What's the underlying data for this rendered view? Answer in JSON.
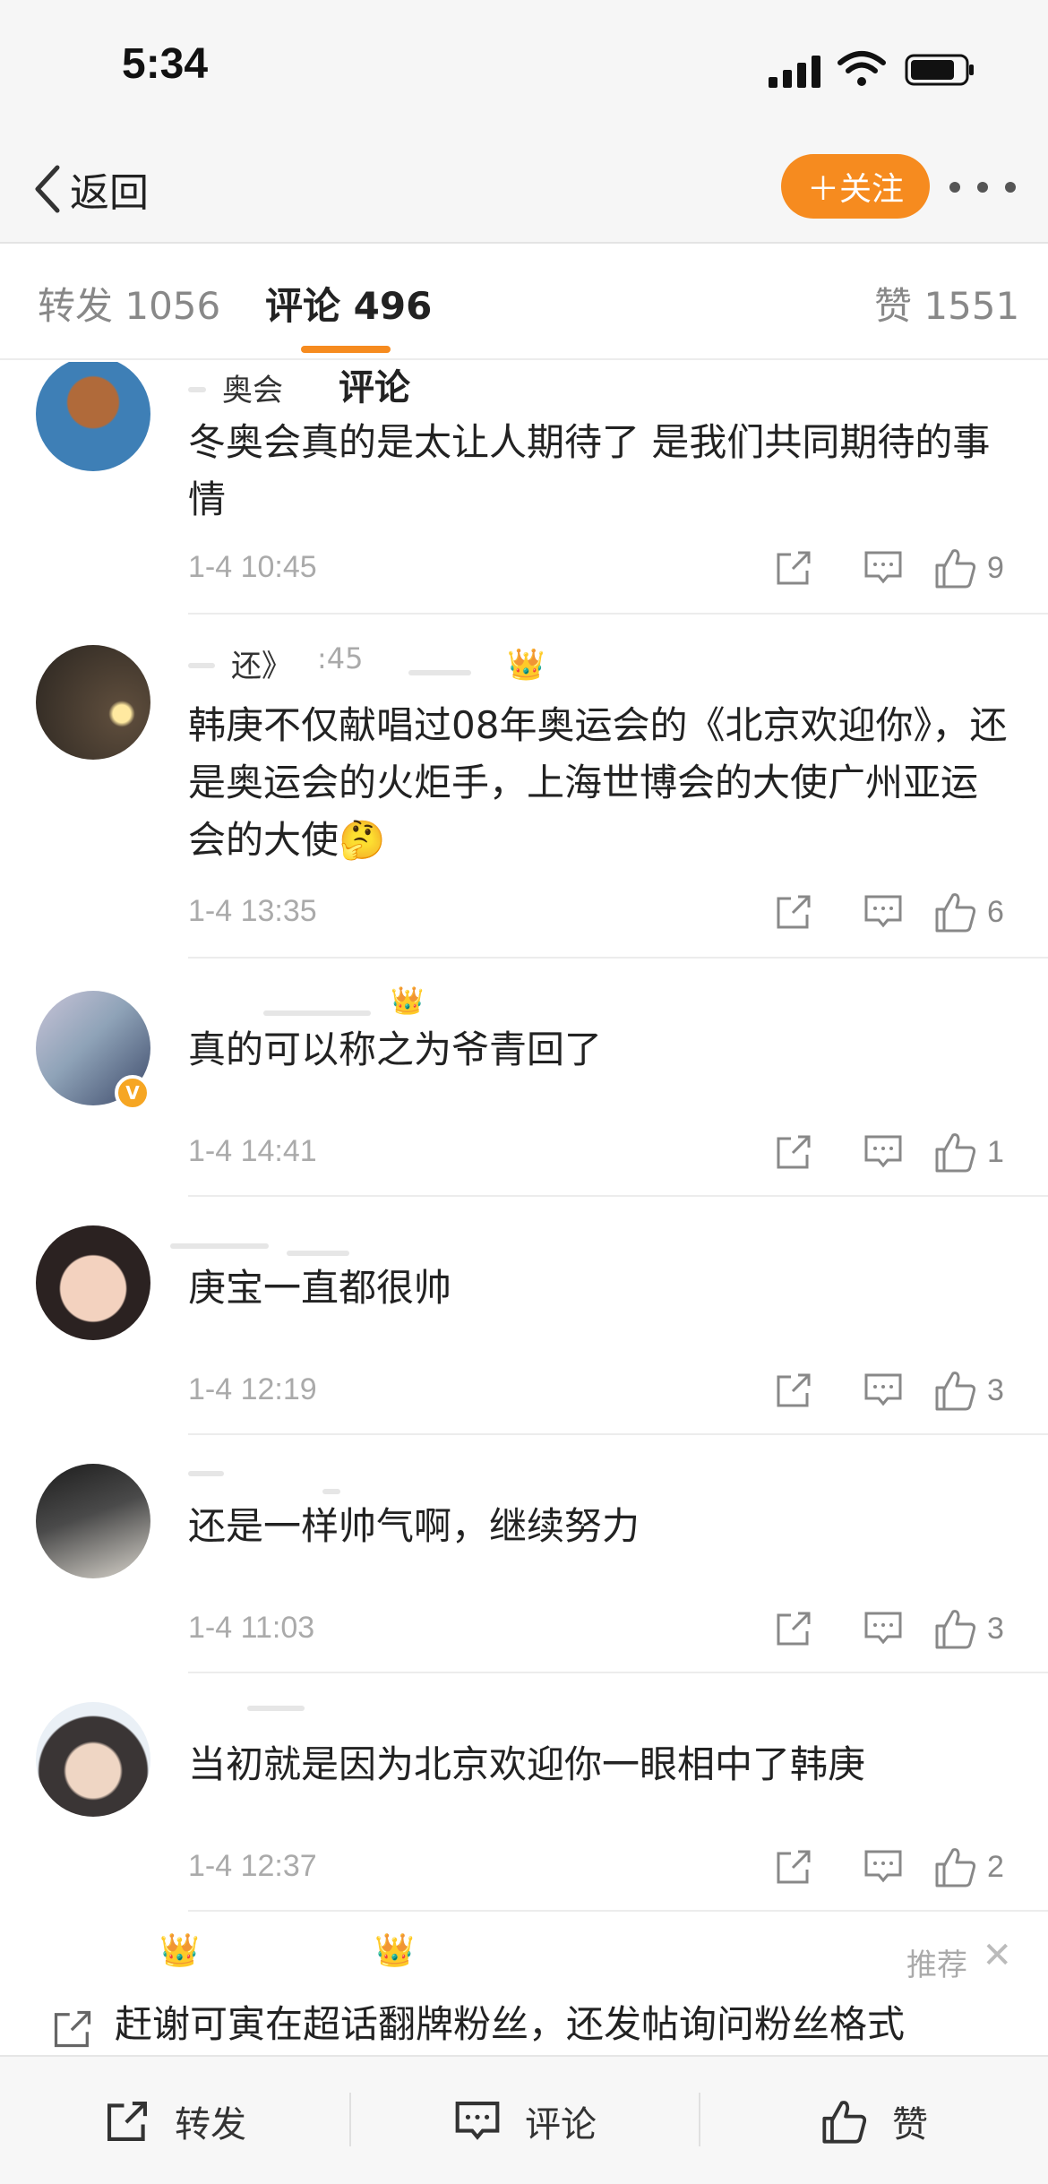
{
  "status_bar": {
    "time": "5:34"
  },
  "nav": {
    "back_label": "返回",
    "follow_label": "＋关注"
  },
  "tabs": {
    "repost": "转发 1056",
    "comments": "评论 496",
    "likes": "赞 1551"
  },
  "comments": [
    {
      "username_fragment": "奥会",
      "overlay_label": "评论",
      "text": "冬奥会真的是太让人期待了 是我们共同期待的事情",
      "time": "1-4 10:45",
      "likes": "9"
    },
    {
      "username_fragment": "还》",
      "username_suffix": ":45",
      "text": "韩庚不仅献唱过08年奥运会的《北京欢迎你》，还是奥运会的火炬手，上海世博会的大使广州亚运会的大使",
      "emoji": "🤔",
      "time": "1-4 13:35",
      "likes": "6"
    },
    {
      "text": "真的可以称之为爷青回了",
      "time": "1-4 14:41",
      "likes": "1",
      "verified": true
    },
    {
      "text": "庚宝一直都很帅",
      "time": "1-4 12:19",
      "likes": "3"
    },
    {
      "text": "还是一样帅气啊，继续努力",
      "time": "1-4 11:03",
      "likes": "3"
    },
    {
      "text": "当初就是因为北京欢迎你一眼相中了韩庚",
      "time": "1-4 12:37",
      "likes": "2"
    }
  ],
  "recommended": {
    "label": "推荐",
    "close": "✕",
    "text": "赶谢可寅在超话翻牌粉丝，还发帖询问粉丝格式"
  },
  "bottom_bar": {
    "repost": "转发",
    "comment": "评论",
    "like": "赞"
  },
  "colors": {
    "accent": "#f68b1f",
    "badge": "#f6a623",
    "bar_background": "#f6f6f6"
  }
}
